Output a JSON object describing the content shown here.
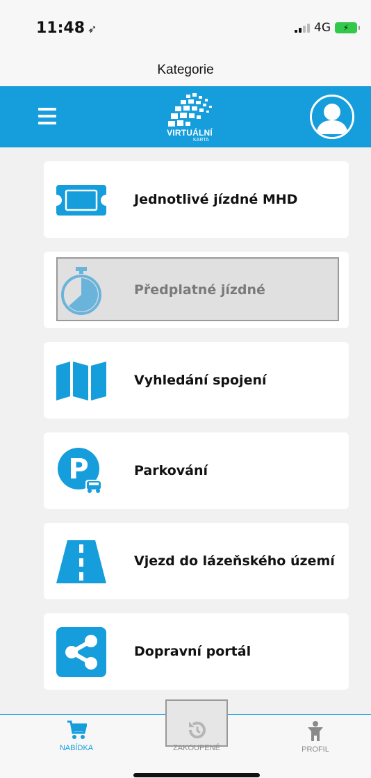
{
  "status_bar": {
    "time": "11:48",
    "network": "4G"
  },
  "title": "Kategorie",
  "header": {
    "logo_text": "VIRTUÁLNÍ",
    "logo_subtext": "KARTA"
  },
  "menu": {
    "items": [
      {
        "label": "Jednotlivé jízdné MHD",
        "icon": "ticket-icon"
      },
      {
        "label": "Předplatné jízdné",
        "icon": "stopwatch-icon",
        "disabled": true
      },
      {
        "label": "Vyhledání spojení",
        "icon": "map-icon"
      },
      {
        "label": "Parkování",
        "icon": "parking-icon"
      },
      {
        "label": "Vjezd do lázeňského území",
        "icon": "road-icon"
      },
      {
        "label": "Dopravní portál",
        "icon": "share-icon"
      }
    ]
  },
  "tabs": [
    {
      "label": "NABÍDKA",
      "icon": "cart-icon",
      "active": true
    },
    {
      "label": "ZAKOUPENÉ",
      "icon": "history-icon",
      "active": false
    },
    {
      "label": "PROFIL",
      "icon": "person-icon",
      "active": false
    }
  ],
  "colors": {
    "accent": "#159ddc",
    "icon_blue": "#169ddc",
    "disabled_bg": "#e0e0e0"
  }
}
